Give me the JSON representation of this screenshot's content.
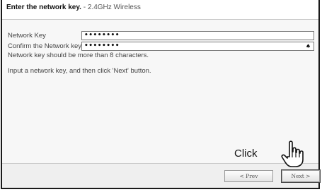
{
  "header": {
    "title_bold": "Enter the network key.",
    "title_rest": " - 2.4GHz Wireless"
  },
  "form": {
    "network_key": {
      "label": "Network Key",
      "value": "••••••••"
    },
    "confirm_key": {
      "label": "Confirm the Network key",
      "value": "••••••••",
      "reveal_glyph": "♠"
    },
    "hint": "Network key should be more than 8 characters.",
    "instruction": "Input a network key, and then click 'Next' button."
  },
  "annotation": {
    "text": "Click"
  },
  "footer": {
    "prev_label": "< Prev",
    "next_label": "Next >"
  },
  "icons": {
    "hand": "hand-pointer-icon"
  }
}
